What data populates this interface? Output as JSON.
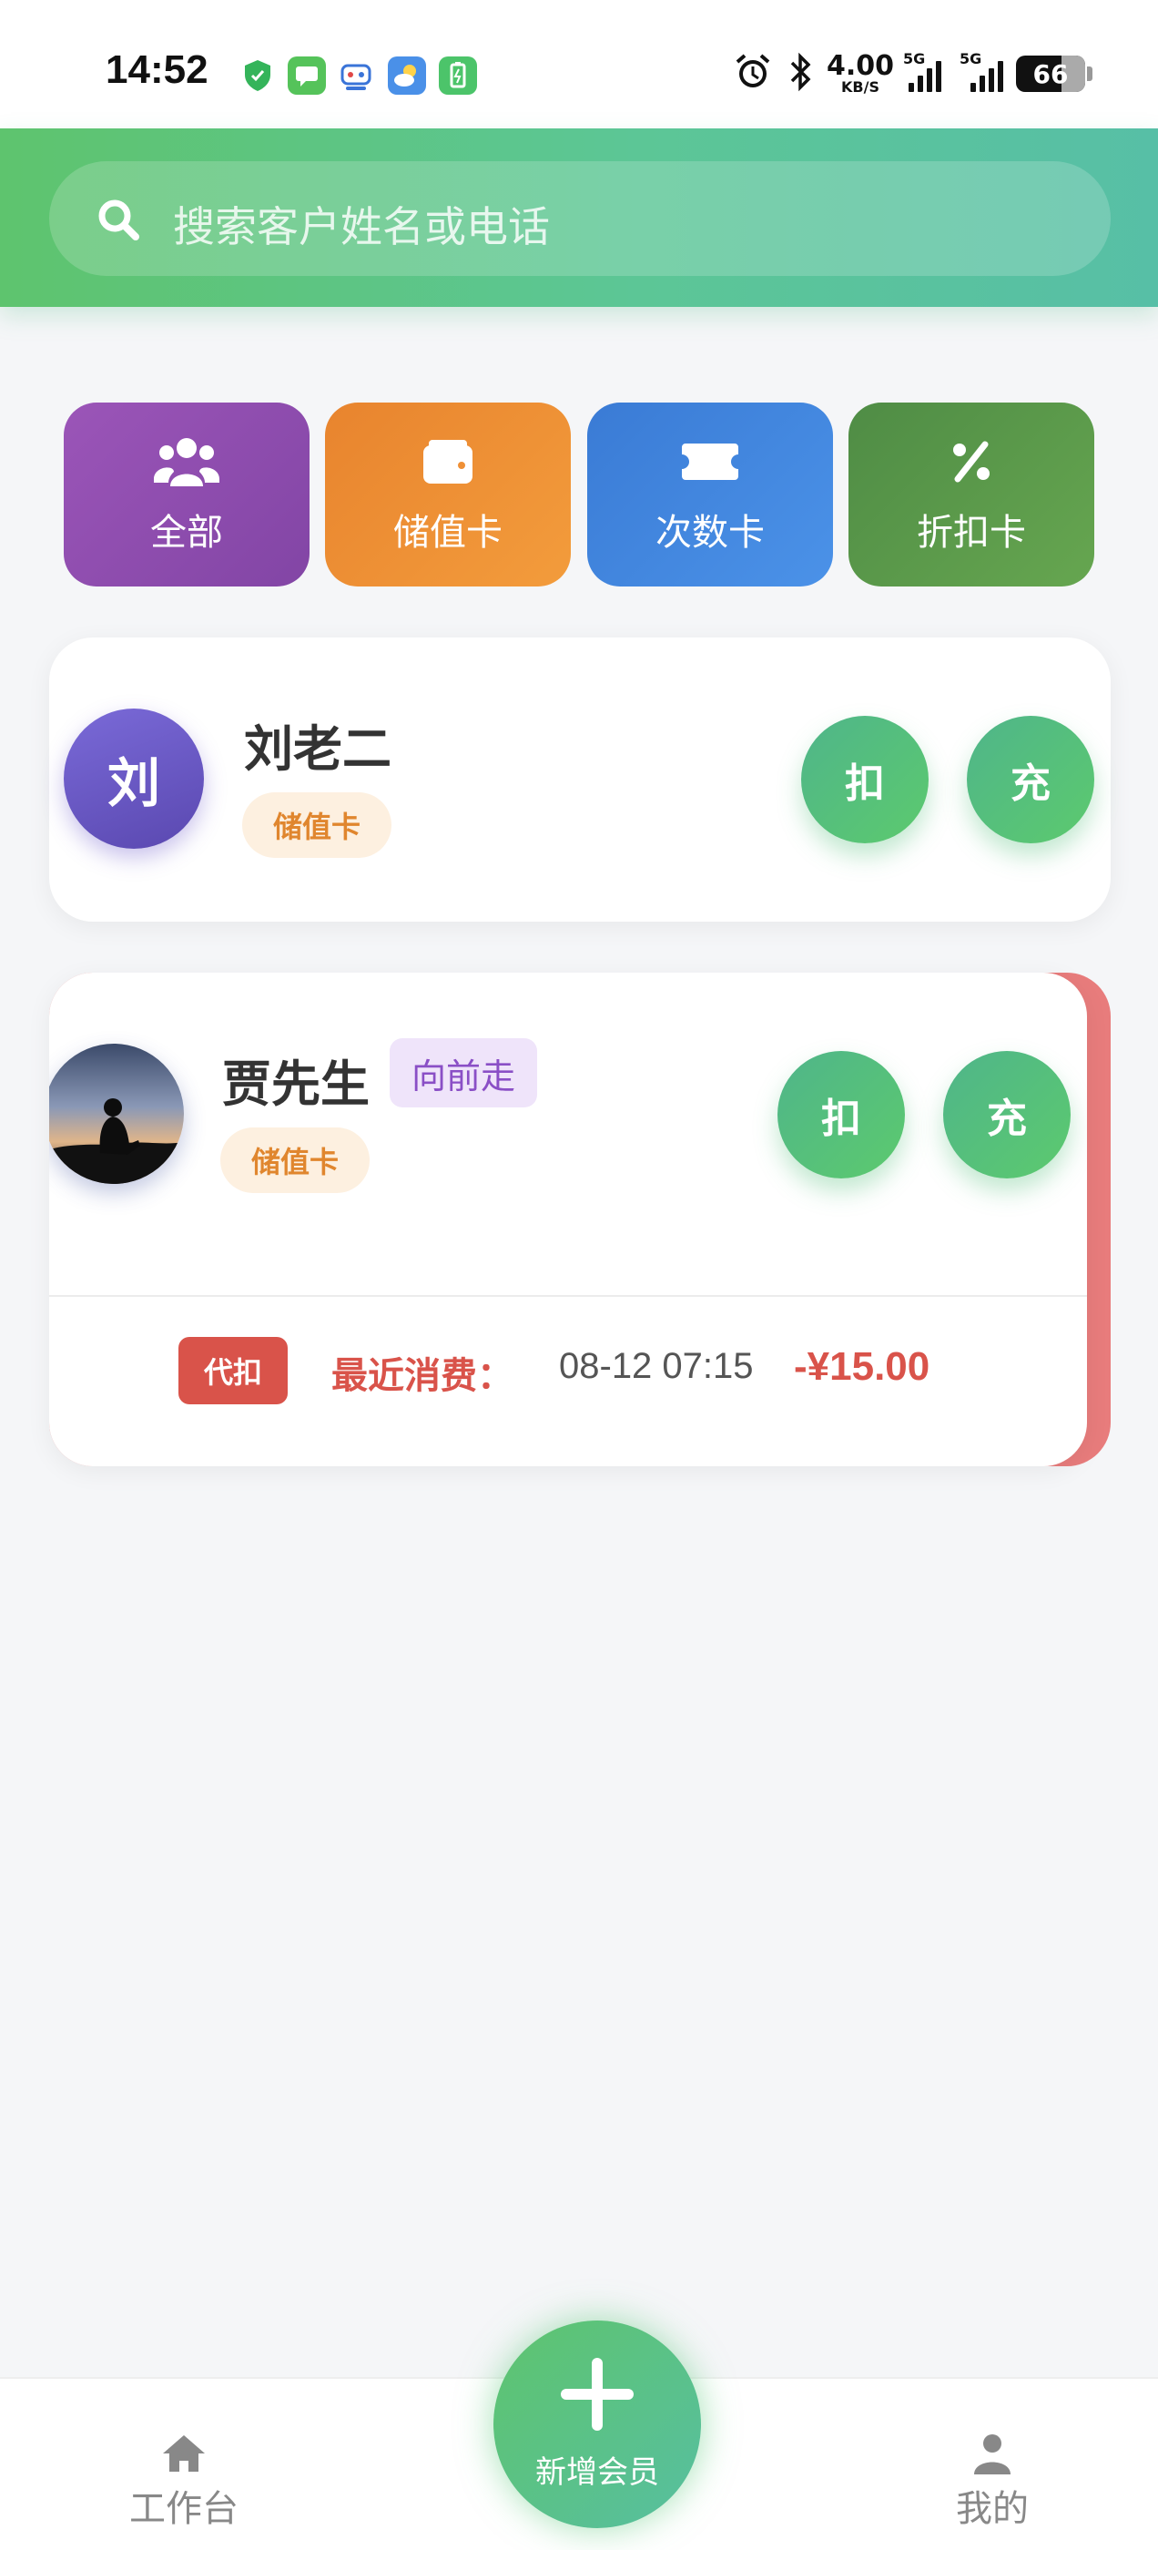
{
  "status_bar": {
    "time": "14:52",
    "net_speed_value": "4.00",
    "net_speed_unit": "KB/S",
    "signal_1_tag": "5G",
    "signal_2_tag": "5G",
    "battery": "66",
    "icons": [
      "shield-icon",
      "message-icon",
      "robot-icon",
      "weather-icon",
      "battery-saver-icon",
      "alarm-icon",
      "bluetooth-icon"
    ]
  },
  "search": {
    "placeholder": "搜索客户姓名或电话"
  },
  "categories": [
    {
      "label": "全部",
      "icon": "users-icon",
      "color": "#8e4cae"
    },
    {
      "label": "储值卡",
      "icon": "wallet-icon",
      "color": "#ee8f34"
    },
    {
      "label": "次数卡",
      "icon": "ticket-icon",
      "color": "#4286de"
    },
    {
      "label": "折扣卡",
      "icon": "percent-icon",
      "color": "#5a9a4a"
    }
  ],
  "members": [
    {
      "avatar_letter": "刘",
      "name": "刘老二",
      "card_type": "储值卡",
      "deduct_label": "扣",
      "recharge_label": "充"
    },
    {
      "name": "贾先生",
      "nickname": "向前走",
      "card_type": "储值卡",
      "deduct_label": "扣",
      "recharge_label": "充",
      "proxy_label": "代扣",
      "recent_label": "最近消费：",
      "recent_time": "08-12 07:15",
      "recent_amount": "-¥15.00"
    }
  ],
  "bottom_nav": {
    "home_label": "工作台",
    "add_label": "新增会员",
    "mine_label": "我的"
  },
  "colors": {
    "accent_green": "#5cc47c",
    "danger_red": "#d9534a",
    "stored_orange": "#e0862e"
  }
}
